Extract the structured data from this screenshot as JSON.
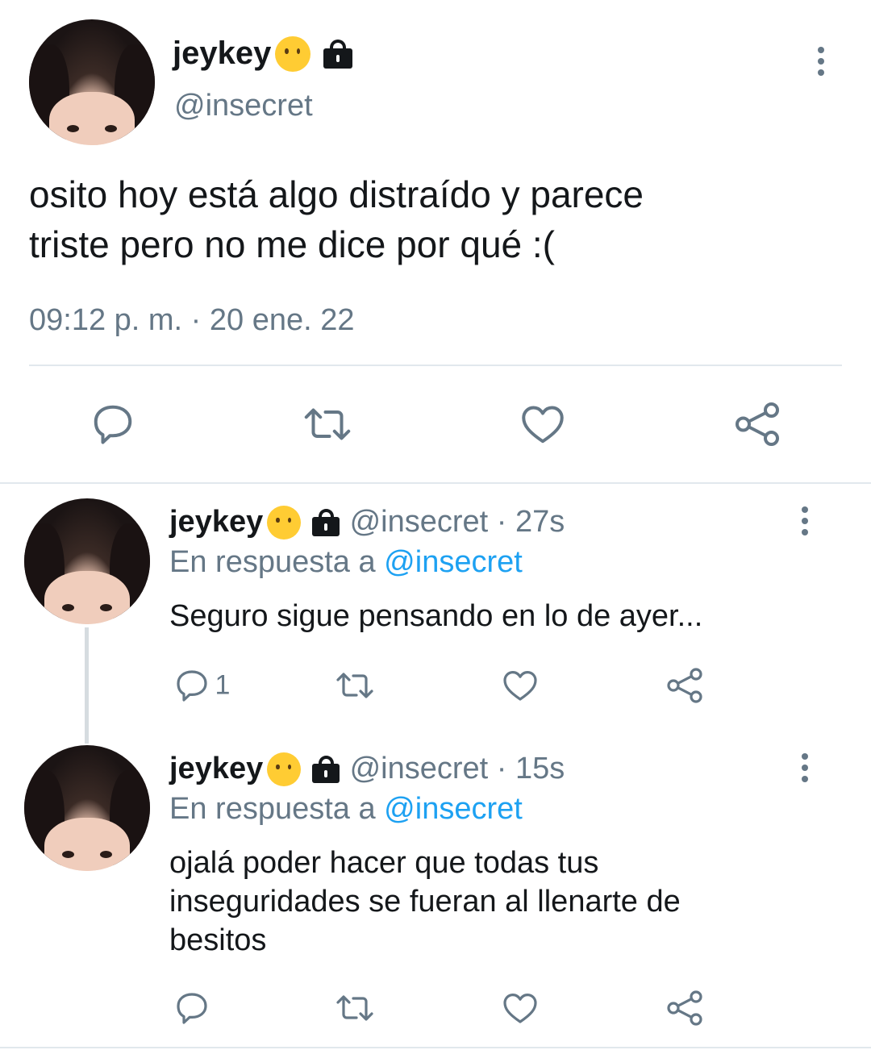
{
  "main_tweet": {
    "display_name": "jeykey",
    "emoji_icon": "shushing-face-emoji",
    "lock_icon": "lock-icon",
    "handle": "@insecret",
    "text_line1": "osito hoy está algo distraído y parece",
    "text_line2": "triste pero no me dice por qué :(",
    "timestamp": "09:12 p. m. · 20 ene. 22"
  },
  "replies": [
    {
      "display_name": "jeykey",
      "handle_time": "@insecret · 27s",
      "reply_prefix": "En respuesta a",
      "reply_to": "@insecret",
      "text_lines": [
        "Seguro sigue pensando en lo de ayer..."
      ],
      "reply_count": "1"
    },
    {
      "display_name": "jeykey",
      "handle_time": "@insecret · 15s",
      "reply_prefix": "En respuesta a",
      "reply_to": "@insecret",
      "text_lines": [
        "ojalá poder hacer que todas tus",
        "inseguridades se fueran al llenarte de",
        "besitos"
      ],
      "reply_count": ""
    }
  ],
  "colors": {
    "text": "#14171a",
    "muted": "#657786",
    "link": "#1da1f2",
    "divider": "#e1e8ed"
  }
}
